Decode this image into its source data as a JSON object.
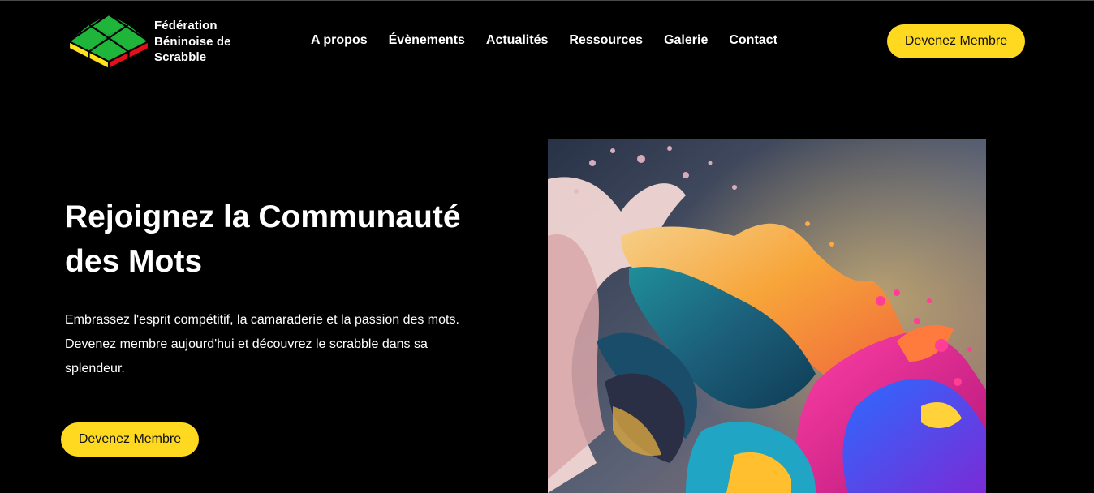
{
  "brand": {
    "name_lines": [
      "Fédération",
      "Béninoise de",
      "Scrabble"
    ],
    "colors": {
      "green": "#1fb43a",
      "yellow": "#ffe21a",
      "red": "#e3101b"
    }
  },
  "nav": {
    "items": [
      {
        "label": "A propos"
      },
      {
        "label": "Évènements"
      },
      {
        "label": "Actualités"
      },
      {
        "label": "Ressources"
      },
      {
        "label": "Galerie"
      },
      {
        "label": "Contact"
      }
    ]
  },
  "header": {
    "cta_label": "Devenez Membre"
  },
  "hero": {
    "title": "Rejoignez la Communauté des Mots",
    "description": "Embrassez l'esprit compétitif, la camaraderie et la passion des mots. Devenez membre aujourd'hui et découvrez le scrabble dans sa splendeur.",
    "cta_label": "Devenez Membre",
    "image": "colorful-paint-splash-wave"
  },
  "theme": {
    "background": "#000000",
    "accent": "#ffd91f",
    "text": "#ffffff"
  }
}
